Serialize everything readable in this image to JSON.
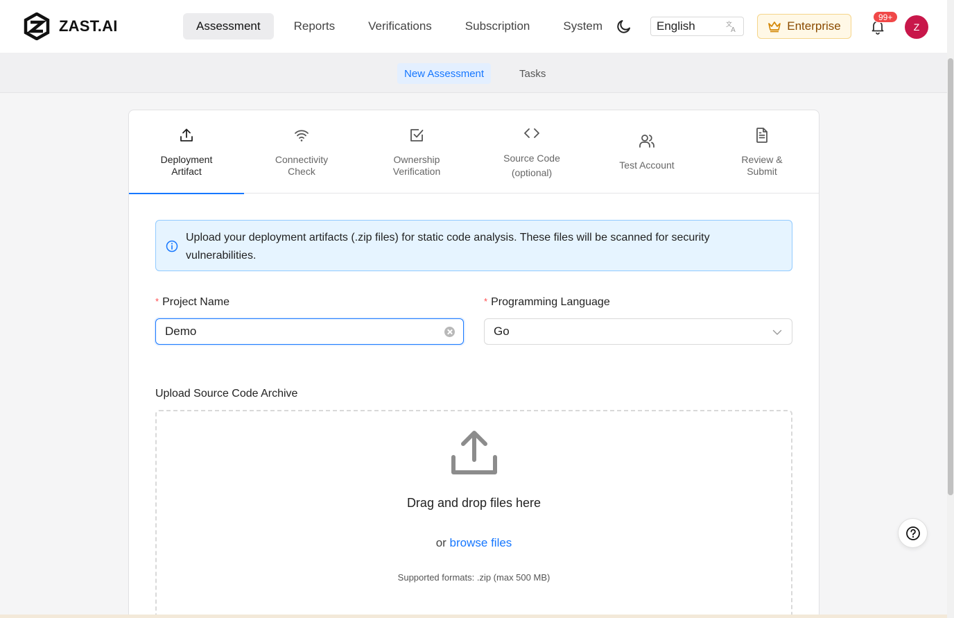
{
  "app": {
    "name": "ZAST.AI"
  },
  "nav": {
    "items": [
      {
        "label": "Assessment",
        "active": true
      },
      {
        "label": "Reports",
        "active": false
      },
      {
        "label": "Verifications",
        "active": false
      },
      {
        "label": "Subscription",
        "active": false
      },
      {
        "label": "System",
        "active": false
      }
    ]
  },
  "header": {
    "theme_icon": "moon-icon",
    "language": "English",
    "plan": "Enterprise",
    "notifications": "99+",
    "avatar_initial": "Z"
  },
  "subnav": {
    "tabs": [
      {
        "label": "New Assessment",
        "active": true
      },
      {
        "label": "Tasks",
        "active": false
      }
    ]
  },
  "steps": [
    {
      "line1": "Deployment",
      "line2": "Artifact",
      "icon": "upload-icon",
      "active": true
    },
    {
      "line1": "Connectivity",
      "line2": "Check",
      "icon": "wifi-icon",
      "active": false
    },
    {
      "line1": "Ownership",
      "line2": "Verification",
      "icon": "checkbox-icon",
      "active": false
    },
    {
      "line1": "Source Code",
      "line2": "(optional)",
      "icon": "code-icon",
      "active": false
    },
    {
      "line1": "Test Account",
      "line2": "",
      "icon": "users-icon",
      "active": false
    },
    {
      "line1": "Review &",
      "line2": "Submit",
      "icon": "document-icon",
      "active": false
    }
  ],
  "info": {
    "text": "Upload your deployment artifacts (.zip files) for static code analysis. These files will be scanned for security vulnerabilities."
  },
  "form": {
    "project_name": {
      "label": "Project Name",
      "value": "Demo",
      "required_mark": "*"
    },
    "language": {
      "label": "Programming Language",
      "value": "Go",
      "required_mark": "*"
    }
  },
  "upload": {
    "label": "Upload Source Code Archive",
    "main": "Drag and drop files here",
    "or": "or",
    "browse": "browse files",
    "formats": "Supported formats: .zip (max 500 MB)"
  },
  "colors": {
    "primary": "#1677ff",
    "avatar": "#c8174a",
    "badge": "#f04848",
    "enterprise_text": "#8a4b00"
  }
}
